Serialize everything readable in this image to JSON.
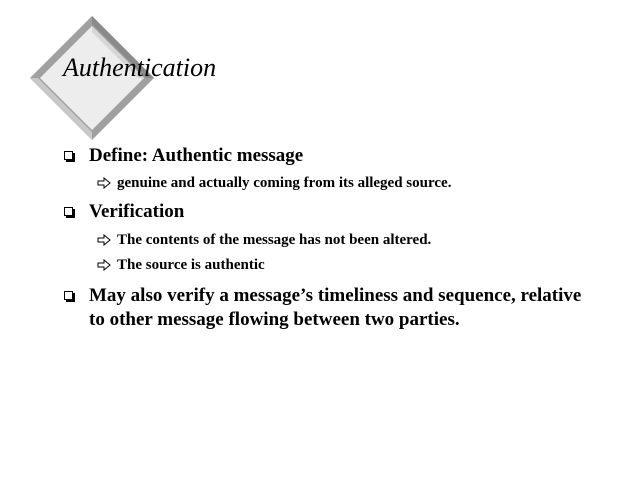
{
  "slide": {
    "title": "Authentication",
    "bullets": [
      {
        "text": "Define: Authentic message",
        "subs": [
          "genuine and actually coming from its alleged source."
        ]
      },
      {
        "text": "Verification",
        "subs": [
          "The contents of the message has not been altered.",
          "The source is authentic"
        ]
      },
      {
        "text": "May also verify a message’s timeliness and sequence, relative to other message flowing between two parties.",
        "subs": []
      }
    ]
  },
  "icons": {
    "title_ornament": "diamond-ornament-icon",
    "bullet_marker": "checkbox-square-icon",
    "sub_bullet_marker": "hollow-arrow-icon"
  },
  "colors": {
    "background": "#ffffff",
    "text": "#000000",
    "ornament_light": "#f2f2f2",
    "ornament_shadow": "#9a9a9a"
  }
}
